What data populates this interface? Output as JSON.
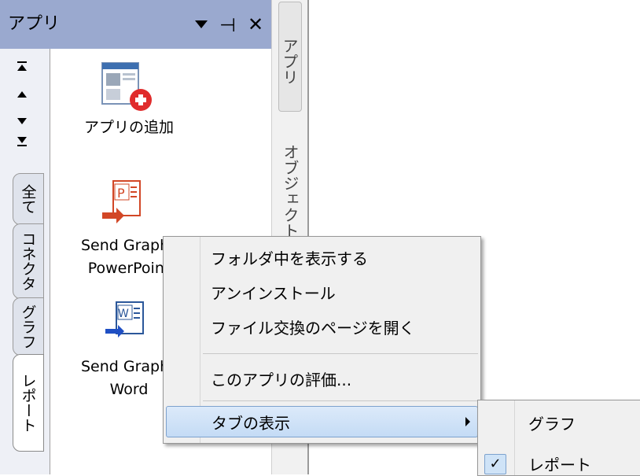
{
  "panel": {
    "title": "アプリ",
    "side_tabs": [
      "全て",
      "コネクタ",
      "グラフ",
      "レポート"
    ],
    "active_tab": "レポート"
  },
  "apps": [
    {
      "label_line1": "アプリの追加",
      "label_line2": "",
      "icon": "add-app-icon"
    },
    {
      "label_line1": "Send Graphs",
      "label_line2": "PowerPoint",
      "icon": "powerpoint-icon"
    },
    {
      "label_line1": "Send Graphs",
      "label_line2": "Word",
      "icon": "word-icon"
    }
  ],
  "right_dock": {
    "tabs": [
      "アプリ",
      "オブジェクト"
    ]
  },
  "context_menu": {
    "items": [
      "フォルダ中を表示する",
      "アンインストール",
      "ファイル交換のページを開く"
    ],
    "rate": "このアプリの評価...",
    "tab_display": "タブの表示"
  },
  "submenu": {
    "items": [
      {
        "label": "グラフ",
        "checked": false
      },
      {
        "label": "レポート",
        "checked": true
      }
    ],
    "check_glyph": "✓"
  },
  "colors": {
    "title_bar": "#9aa9cf",
    "menu_highlight": "#c4dbf5",
    "powerpoint": "#d24726",
    "word": "#2b579a",
    "add_badge": "#e02c2c"
  }
}
